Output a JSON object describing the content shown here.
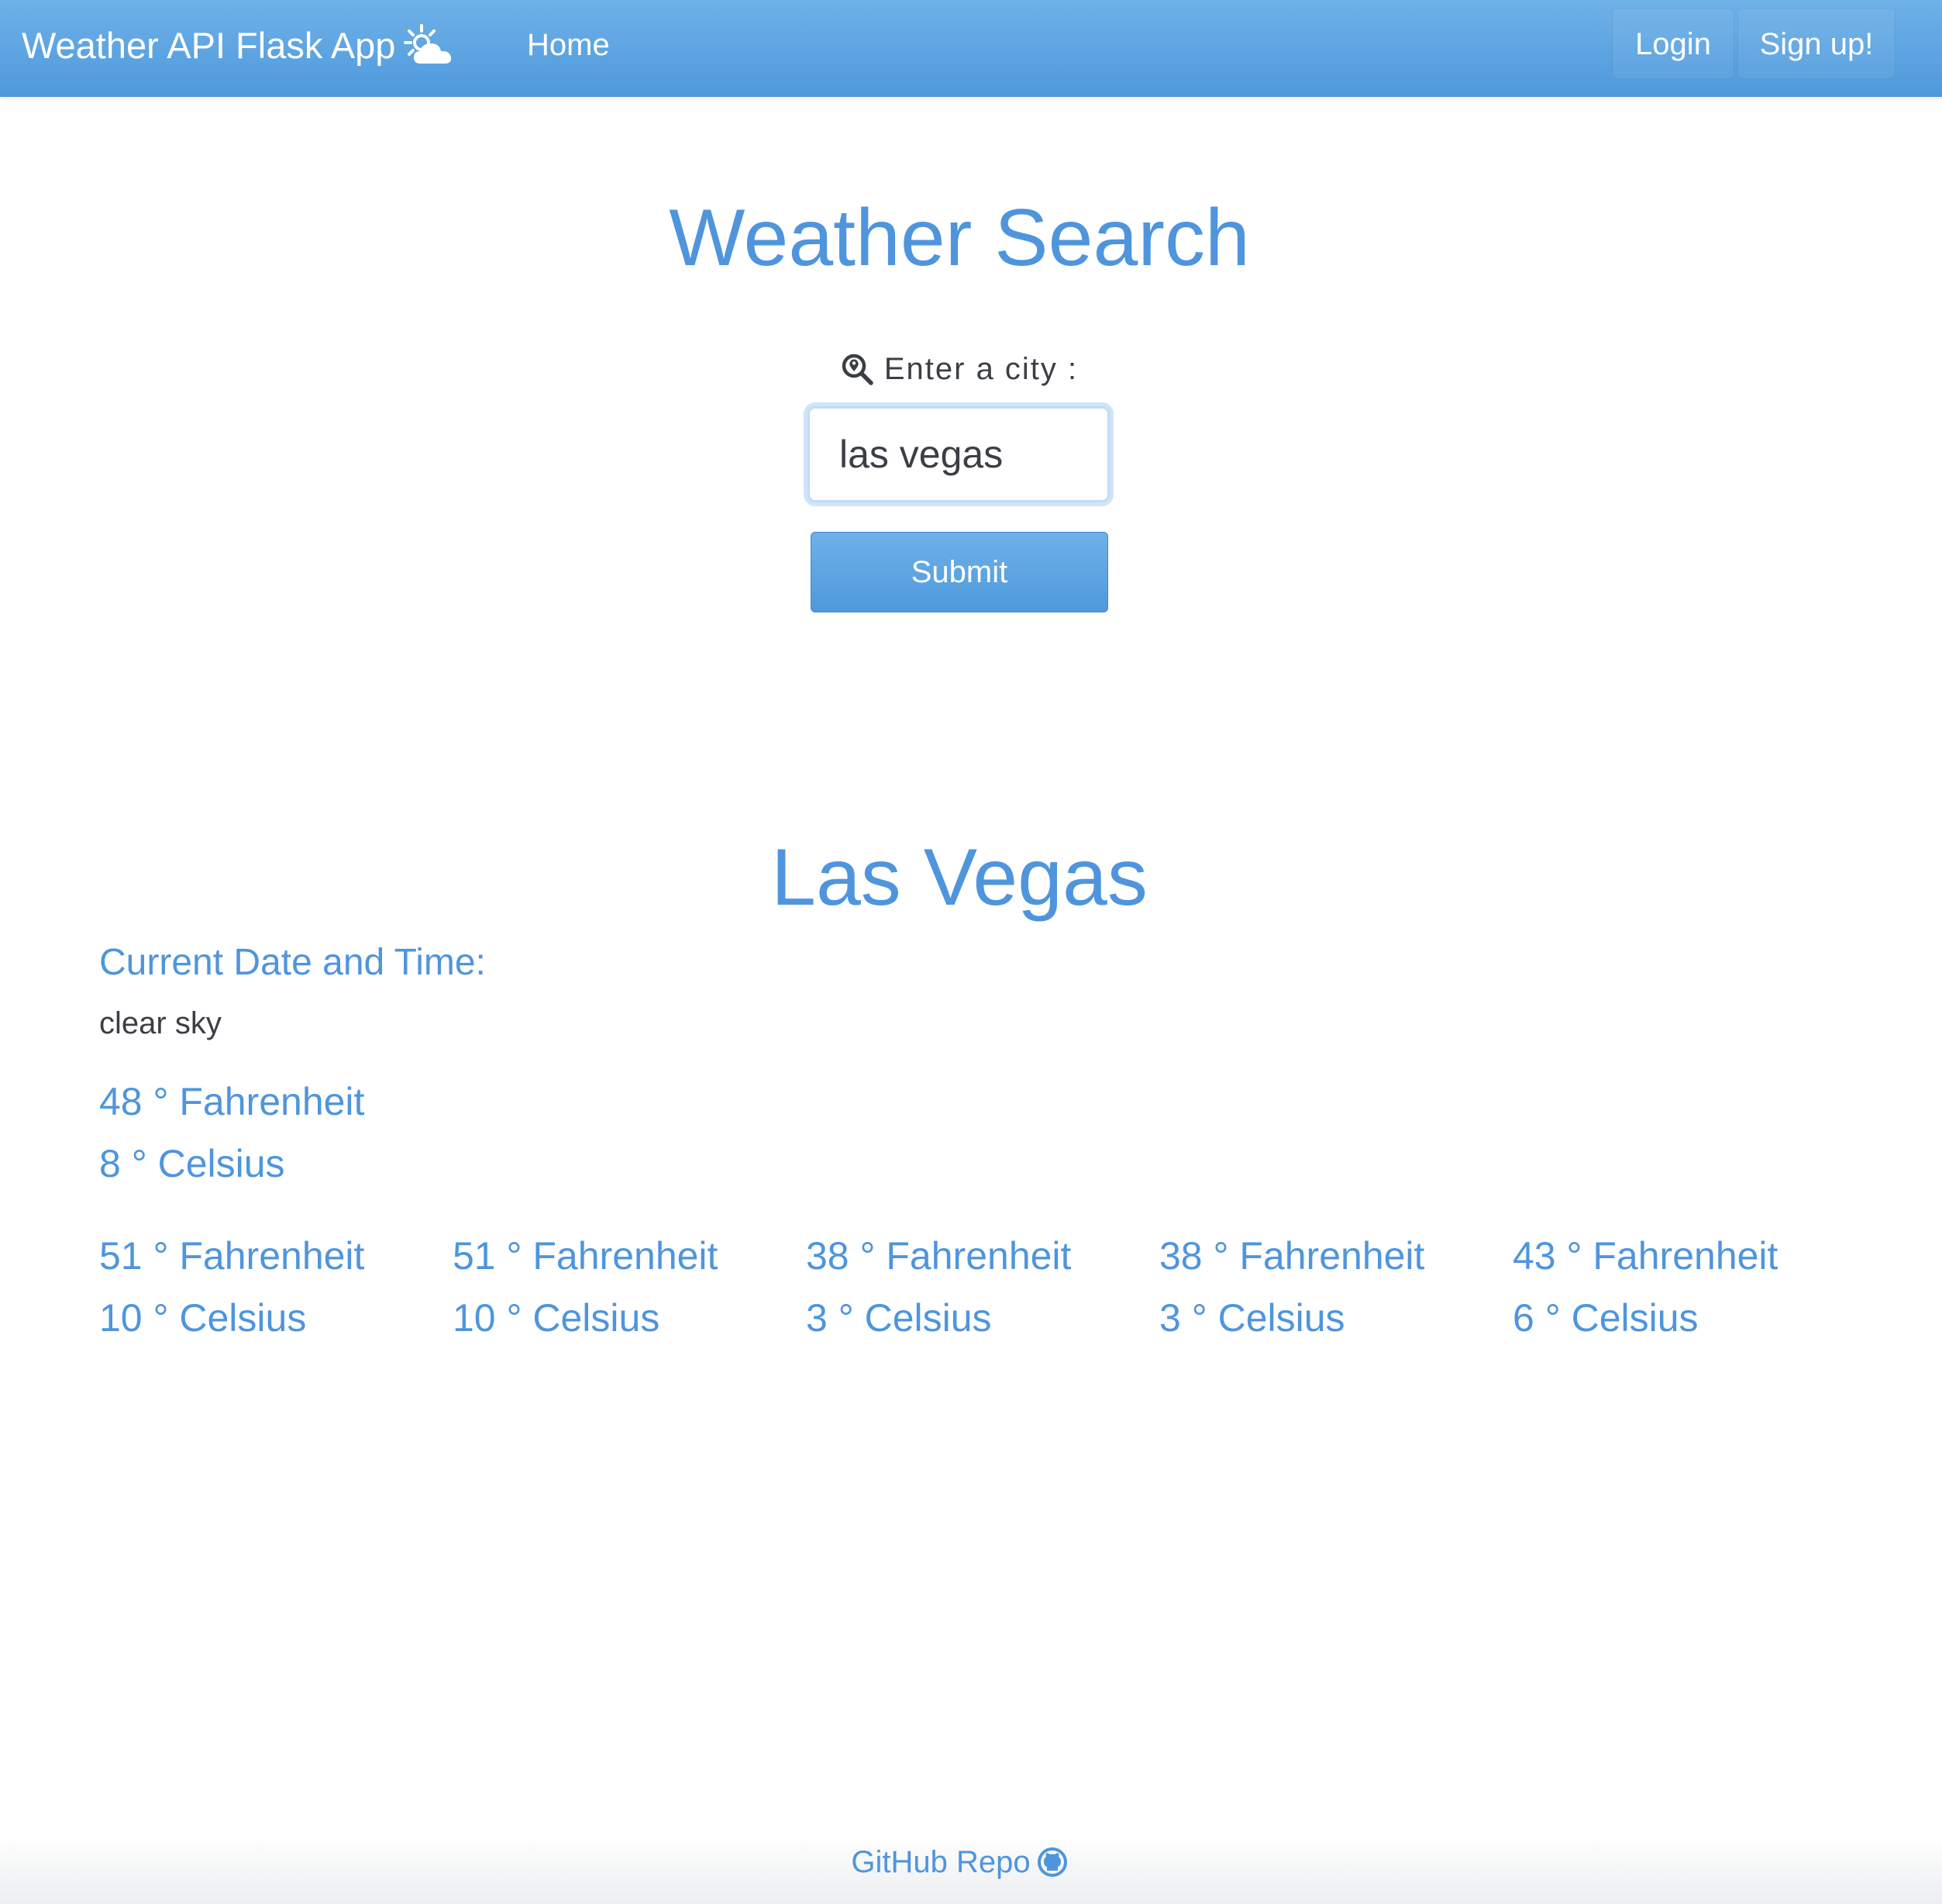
{
  "navbar": {
    "brand": "Weather API Flask App",
    "brand_icon": "sun-cloud-icon",
    "home": "Home",
    "login": "Login",
    "signup": "Sign up!"
  },
  "search": {
    "title": "Weather Search",
    "label": "Enter a city :",
    "label_icon": "search-location-icon",
    "input_value": "las vegas",
    "submit": "Submit"
  },
  "result": {
    "city": "Las Vegas",
    "datetime_label": "Current Date and Time:",
    "description": "clear sky",
    "current": {
      "fahrenheit": "48 ° Fahrenheit",
      "celsius": "8 ° Celsius"
    },
    "forecast": [
      {
        "fahrenheit": "51 ° Fahrenheit",
        "celsius": "10 ° Celsius"
      },
      {
        "fahrenheit": "51 ° Fahrenheit",
        "celsius": "10 ° Celsius"
      },
      {
        "fahrenheit": "38 ° Fahrenheit",
        "celsius": "3 ° Celsius"
      },
      {
        "fahrenheit": "38 ° Fahrenheit",
        "celsius": "3 ° Celsius"
      },
      {
        "fahrenheit": "43 ° Fahrenheit",
        "celsius": "6 ° Celsius"
      }
    ]
  },
  "footer": {
    "link": "GitHub Repo",
    "link_icon": "github-icon"
  },
  "colors": {
    "accent": "#4f95dd",
    "navbar_top": "#6eb1e8",
    "navbar_bottom": "#4f99dc",
    "text_dark": "#3b3f45"
  }
}
